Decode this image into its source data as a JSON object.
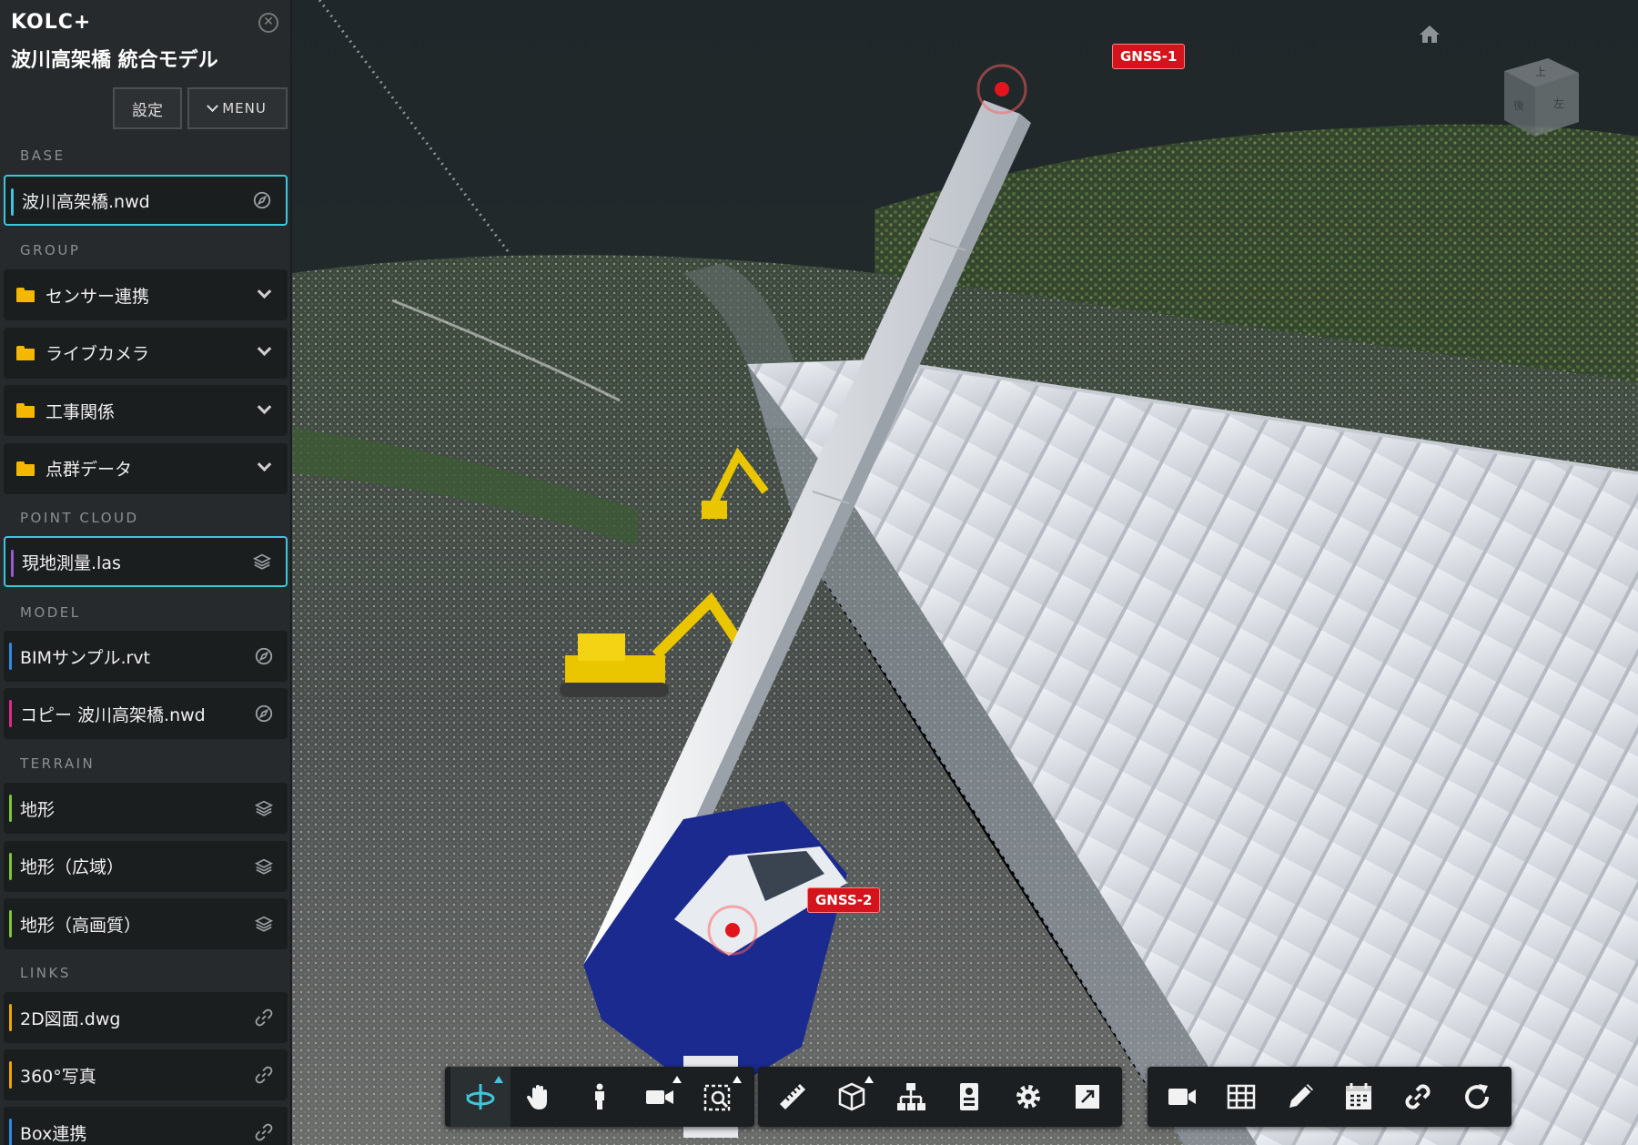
{
  "app": {
    "brand": "KOLC+",
    "project_title": "波川高架橋 統合モデル",
    "settings_label": "設定",
    "menu_label": "MENU"
  },
  "sections": {
    "base": "BASE",
    "group": "GROUP",
    "point_cloud": "POINT CLOUD",
    "model": "MODEL",
    "terrain": "TERRAIN",
    "links": "LINKS"
  },
  "base_items": [
    {
      "label": "波川高架橋.nwd",
      "color": "#3ec6dc",
      "icon": "compass-icon",
      "selected": true
    }
  ],
  "group_items": [
    {
      "label": "センサー連携"
    },
    {
      "label": "ライブカメラ"
    },
    {
      "label": "工事関係"
    },
    {
      "label": "点群データ"
    }
  ],
  "point_cloud_items": [
    {
      "label": "現地測量.las",
      "color": "#9b59d0",
      "icon": "layers-icon",
      "selected": true
    }
  ],
  "model_items": [
    {
      "label": "BIMサンプル.rvt",
      "color": "#2d8ae6",
      "icon": "compass-icon"
    },
    {
      "label": "コピー 波川高架橋.nwd",
      "color": "#e0288c",
      "icon": "compass-icon"
    }
  ],
  "terrain_items": [
    {
      "label": "地形",
      "color": "#7cc63a",
      "icon": "layers-icon"
    },
    {
      "label": "地形（広域）",
      "color": "#7cc63a",
      "icon": "layers-icon"
    },
    {
      "label": "地形（高画質）",
      "color": "#7cc63a",
      "icon": "layers-icon"
    }
  ],
  "link_items": [
    {
      "label": "2D図面.dwg",
      "color": "#f0a500",
      "icon": "link-icon"
    },
    {
      "label": "360°写真",
      "color": "#f0a500",
      "icon": "link-icon"
    },
    {
      "label": "Box連携",
      "color": "#2d8ae6",
      "icon": "link-icon"
    }
  ],
  "viewport": {
    "gnss1": "GNSS-1",
    "gnss2": "GNSS-2",
    "viewcube_top": "上",
    "viewcube_front": "後",
    "viewcube_right": "左"
  },
  "colors": {
    "accent": "#3ec6dc",
    "marker": "#d4141c",
    "folder": "#f5b800"
  }
}
